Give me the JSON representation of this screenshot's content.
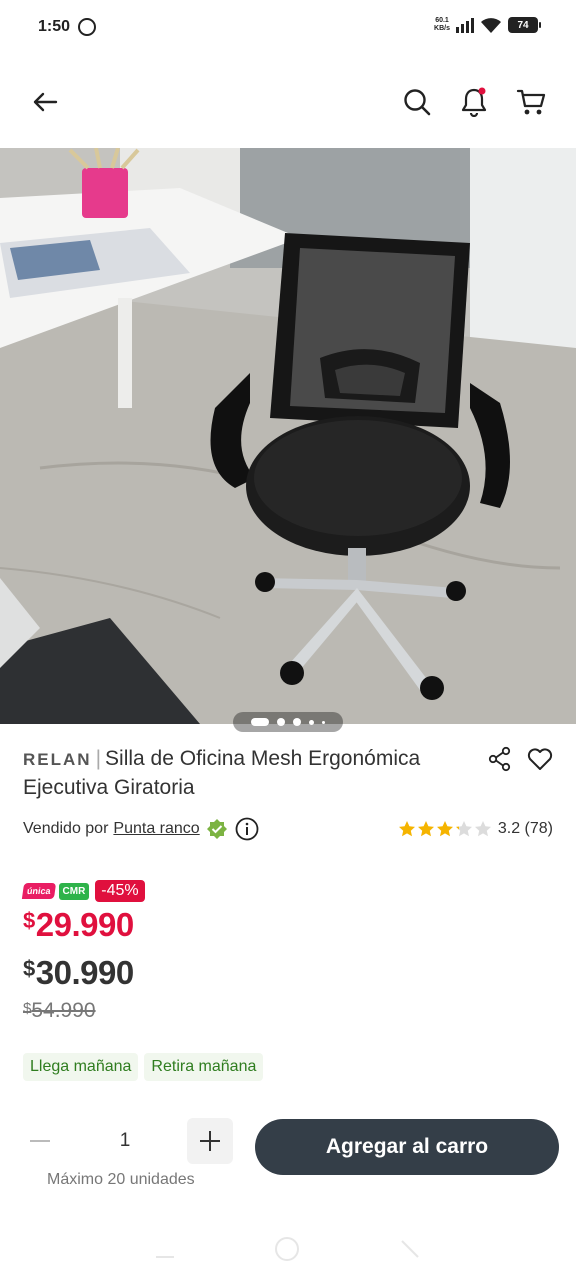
{
  "status_bar": {
    "time": "1:50",
    "net_speed_value": "60.1",
    "net_speed_unit": "KB/s",
    "battery": "74"
  },
  "top_nav": {
    "icons": [
      "back-arrow-icon",
      "search-icon",
      "notification-bell-icon",
      "cart-icon"
    ],
    "notification_dot_color": "#e0103e"
  },
  "carousel": {
    "total_dots": 5,
    "active_index": 0
  },
  "product": {
    "brand": "RELAN",
    "separator": "|",
    "title": "Silla de Oficina Mesh Ergonómica Ejecutiva Giratoria",
    "seller_prefix": "Vendido por",
    "seller_name": "Punta ranco",
    "rating_value": "3.2",
    "rating_count": "(78)",
    "rating_stars": 3.2,
    "max_stars": 5
  },
  "pricing": {
    "badge_unica": "única",
    "badge_cmr": "CMR",
    "discount": "-45%",
    "currency_symbol": "$",
    "cmr_price": "29.990",
    "price": "30.990",
    "old_price": "54.990",
    "cmr_color": "#e0103e"
  },
  "delivery": {
    "tags": [
      "Llega mañana",
      "Retira mañana"
    ],
    "tag_color": "#2f7d1f"
  },
  "purchase": {
    "quantity": "1",
    "max_units": "Máximo 20 unidades",
    "add_to_cart": "Agregar al carro",
    "button_color": "#343e48"
  }
}
